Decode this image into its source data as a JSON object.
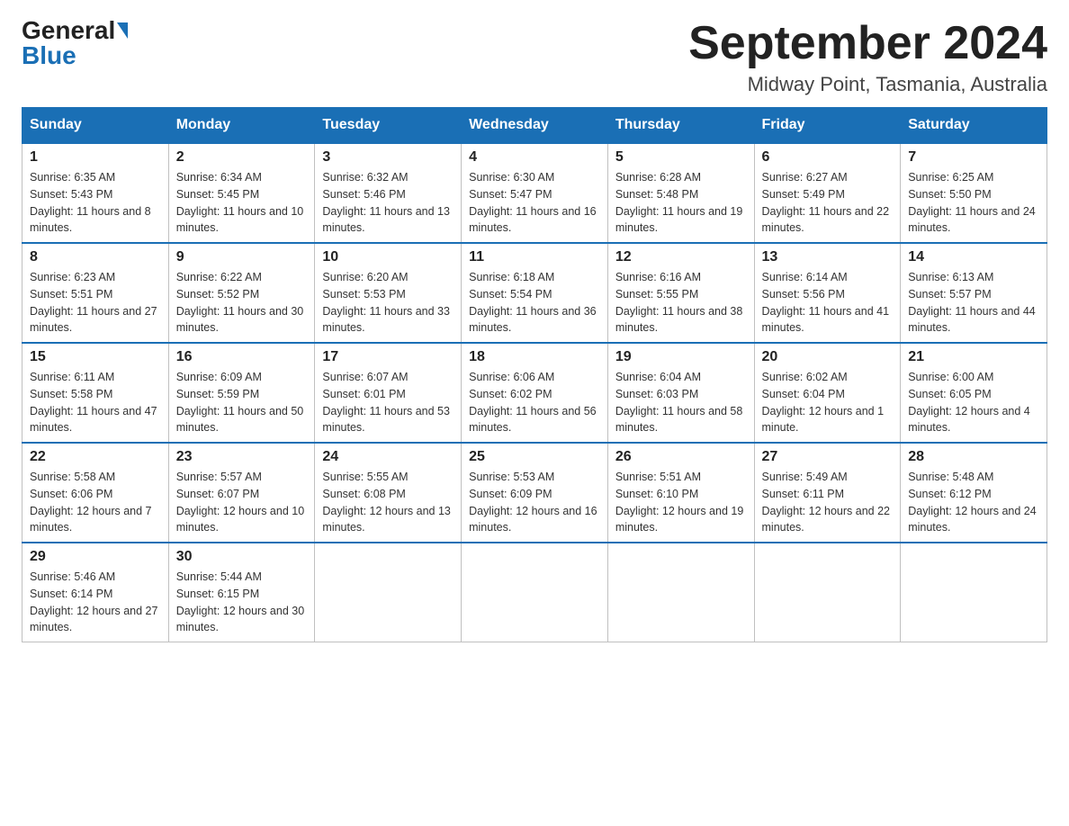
{
  "header": {
    "logo_line1": "General",
    "logo_line2": "Blue",
    "cal_title": "September 2024",
    "cal_subtitle": "Midway Point, Tasmania, Australia"
  },
  "days_of_week": [
    "Sunday",
    "Monday",
    "Tuesday",
    "Wednesday",
    "Thursday",
    "Friday",
    "Saturday"
  ],
  "weeks": [
    [
      {
        "day": "1",
        "sunrise": "6:35 AM",
        "sunset": "5:43 PM",
        "daylight": "11 hours and 8 minutes."
      },
      {
        "day": "2",
        "sunrise": "6:34 AM",
        "sunset": "5:45 PM",
        "daylight": "11 hours and 10 minutes."
      },
      {
        "day": "3",
        "sunrise": "6:32 AM",
        "sunset": "5:46 PM",
        "daylight": "11 hours and 13 minutes."
      },
      {
        "day": "4",
        "sunrise": "6:30 AM",
        "sunset": "5:47 PM",
        "daylight": "11 hours and 16 minutes."
      },
      {
        "day": "5",
        "sunrise": "6:28 AM",
        "sunset": "5:48 PM",
        "daylight": "11 hours and 19 minutes."
      },
      {
        "day": "6",
        "sunrise": "6:27 AM",
        "sunset": "5:49 PM",
        "daylight": "11 hours and 22 minutes."
      },
      {
        "day": "7",
        "sunrise": "6:25 AM",
        "sunset": "5:50 PM",
        "daylight": "11 hours and 24 minutes."
      }
    ],
    [
      {
        "day": "8",
        "sunrise": "6:23 AM",
        "sunset": "5:51 PM",
        "daylight": "11 hours and 27 minutes."
      },
      {
        "day": "9",
        "sunrise": "6:22 AM",
        "sunset": "5:52 PM",
        "daylight": "11 hours and 30 minutes."
      },
      {
        "day": "10",
        "sunrise": "6:20 AM",
        "sunset": "5:53 PM",
        "daylight": "11 hours and 33 minutes."
      },
      {
        "day": "11",
        "sunrise": "6:18 AM",
        "sunset": "5:54 PM",
        "daylight": "11 hours and 36 minutes."
      },
      {
        "day": "12",
        "sunrise": "6:16 AM",
        "sunset": "5:55 PM",
        "daylight": "11 hours and 38 minutes."
      },
      {
        "day": "13",
        "sunrise": "6:14 AM",
        "sunset": "5:56 PM",
        "daylight": "11 hours and 41 minutes."
      },
      {
        "day": "14",
        "sunrise": "6:13 AM",
        "sunset": "5:57 PM",
        "daylight": "11 hours and 44 minutes."
      }
    ],
    [
      {
        "day": "15",
        "sunrise": "6:11 AM",
        "sunset": "5:58 PM",
        "daylight": "11 hours and 47 minutes."
      },
      {
        "day": "16",
        "sunrise": "6:09 AM",
        "sunset": "5:59 PM",
        "daylight": "11 hours and 50 minutes."
      },
      {
        "day": "17",
        "sunrise": "6:07 AM",
        "sunset": "6:01 PM",
        "daylight": "11 hours and 53 minutes."
      },
      {
        "day": "18",
        "sunrise": "6:06 AM",
        "sunset": "6:02 PM",
        "daylight": "11 hours and 56 minutes."
      },
      {
        "day": "19",
        "sunrise": "6:04 AM",
        "sunset": "6:03 PM",
        "daylight": "11 hours and 58 minutes."
      },
      {
        "day": "20",
        "sunrise": "6:02 AM",
        "sunset": "6:04 PM",
        "daylight": "12 hours and 1 minute."
      },
      {
        "day": "21",
        "sunrise": "6:00 AM",
        "sunset": "6:05 PM",
        "daylight": "12 hours and 4 minutes."
      }
    ],
    [
      {
        "day": "22",
        "sunrise": "5:58 AM",
        "sunset": "6:06 PM",
        "daylight": "12 hours and 7 minutes."
      },
      {
        "day": "23",
        "sunrise": "5:57 AM",
        "sunset": "6:07 PM",
        "daylight": "12 hours and 10 minutes."
      },
      {
        "day": "24",
        "sunrise": "5:55 AM",
        "sunset": "6:08 PM",
        "daylight": "12 hours and 13 minutes."
      },
      {
        "day": "25",
        "sunrise": "5:53 AM",
        "sunset": "6:09 PM",
        "daylight": "12 hours and 16 minutes."
      },
      {
        "day": "26",
        "sunrise": "5:51 AM",
        "sunset": "6:10 PM",
        "daylight": "12 hours and 19 minutes."
      },
      {
        "day": "27",
        "sunrise": "5:49 AM",
        "sunset": "6:11 PM",
        "daylight": "12 hours and 22 minutes."
      },
      {
        "day": "28",
        "sunrise": "5:48 AM",
        "sunset": "6:12 PM",
        "daylight": "12 hours and 24 minutes."
      }
    ],
    [
      {
        "day": "29",
        "sunrise": "5:46 AM",
        "sunset": "6:14 PM",
        "daylight": "12 hours and 27 minutes."
      },
      {
        "day": "30",
        "sunrise": "5:44 AM",
        "sunset": "6:15 PM",
        "daylight": "12 hours and 30 minutes."
      },
      null,
      null,
      null,
      null,
      null
    ]
  ],
  "labels": {
    "sunrise_prefix": "Sunrise: ",
    "sunset_prefix": "Sunset: ",
    "daylight_prefix": "Daylight: "
  }
}
